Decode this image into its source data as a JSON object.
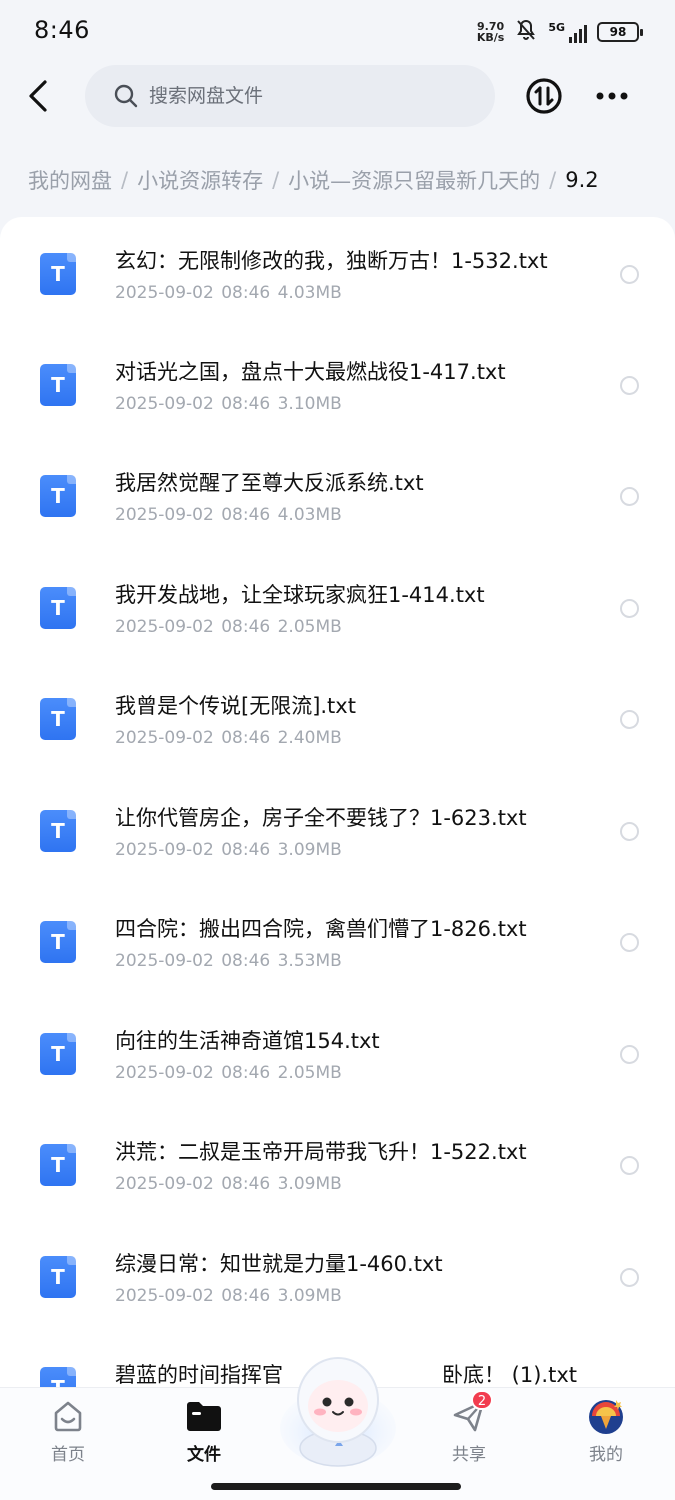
{
  "status_bar": {
    "time": "8:46",
    "net_speed_value": "9.70",
    "net_speed_unit": "KB/s",
    "network": "5G",
    "battery": "98"
  },
  "header": {
    "search_placeholder": "搜索网盘文件"
  },
  "breadcrumb": [
    {
      "label": "我的网盘"
    },
    {
      "label": "小说资源转存"
    },
    {
      "label": "小说—资源只留最新几天的"
    },
    {
      "label": "9.2"
    }
  ],
  "files": [
    {
      "icon_letter": "T",
      "name": "玄幻：无限制修改的我，独断万古！1-532.txt",
      "date": "2025-09-02",
      "time": "08:46",
      "size": "4.03MB"
    },
    {
      "icon_letter": "T",
      "name": "对话光之国，盘点十大最燃战役1-417.txt",
      "date": "2025-09-02",
      "time": "08:46",
      "size": "3.10MB"
    },
    {
      "icon_letter": "T",
      "name": "我居然觉醒了至尊大反派系统.txt",
      "date": "2025-09-02",
      "time": "08:46",
      "size": "4.03MB"
    },
    {
      "icon_letter": "T",
      "name": "我开发战地，让全球玩家疯狂1-414.txt",
      "date": "2025-09-02",
      "time": "08:46",
      "size": "2.05MB"
    },
    {
      "icon_letter": "T",
      "name": "我曾是个传说[无限流].txt",
      "date": "2025-09-02",
      "time": "08:46",
      "size": "2.40MB"
    },
    {
      "icon_letter": "T",
      "name": "让你代管房企，房子全不要钱了？1-623.txt",
      "date": "2025-09-02",
      "time": "08:46",
      "size": "3.09MB"
    },
    {
      "icon_letter": "T",
      "name": "四合院：搬出四合院，禽兽们懵了1-826.txt",
      "date": "2025-09-02",
      "time": "08:46",
      "size": "3.53MB"
    },
    {
      "icon_letter": "T",
      "name": "向往的生活神奇道馆154.txt",
      "date": "2025-09-02",
      "time": "08:46",
      "size": "2.05MB"
    },
    {
      "icon_letter": "T",
      "name": "洪荒：二叔是玉帝开局带我飞升！1-522.txt",
      "date": "2025-09-02",
      "time": "08:46",
      "size": "3.09MB"
    },
    {
      "icon_letter": "T",
      "name": "综漫日常：知世就是力量1-460.txt",
      "date": "2025-09-02",
      "time": "08:46",
      "size": "3.09MB"
    },
    {
      "icon_letter": "T",
      "name": "碧蓝的时间指挥官",
      "name_tail": "卧底！ (1).txt"
    }
  ],
  "bottom_nav": {
    "home": "首页",
    "files": "文件",
    "share": "共享",
    "share_badge": "2",
    "mine": "我的"
  },
  "colors": {
    "accent": "#2f74f1",
    "badge": "#f23d4f",
    "muted_text": "#a3a8b0"
  }
}
